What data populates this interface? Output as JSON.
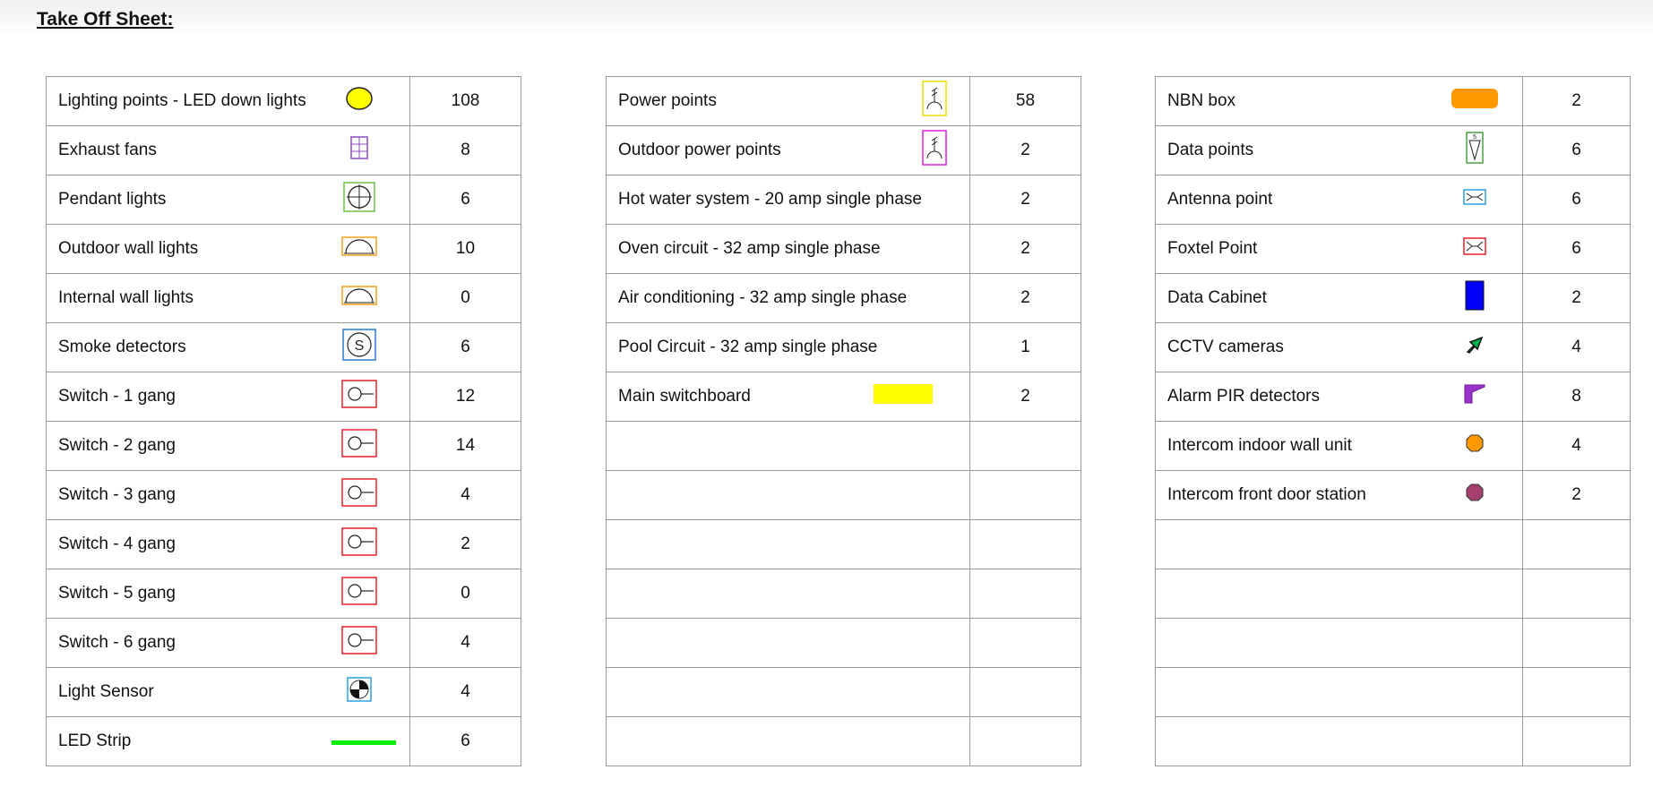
{
  "title": "Take Off Sheet:",
  "tables": [
    {
      "rows": [
        {
          "label": "Lighting points - LED down lights",
          "icon": "yellow-circle-icon",
          "qty": "108"
        },
        {
          "label": "Exhaust fans",
          "icon": "exhaust-fan-icon",
          "qty": "8"
        },
        {
          "label": "Pendant lights",
          "icon": "pendant-light-icon",
          "qty": "6"
        },
        {
          "label": "Outdoor wall lights",
          "icon": "wall-light-icon",
          "qty": "10"
        },
        {
          "label": "Internal wall lights",
          "icon": "wall-light-icon",
          "qty": "0"
        },
        {
          "label": "Smoke detectors",
          "icon": "smoke-detector-icon",
          "qty": "6"
        },
        {
          "label": "Switch - 1 gang",
          "icon": "switch-icon",
          "qty": "12"
        },
        {
          "label": "Switch - 2 gang",
          "icon": "switch-icon",
          "qty": "14"
        },
        {
          "label": "Switch - 3 gang",
          "icon": "switch-icon",
          "qty": "4"
        },
        {
          "label": "Switch - 4 gang",
          "icon": "switch-icon",
          "qty": "2"
        },
        {
          "label": "Switch - 5 gang",
          "icon": "switch-icon",
          "qty": "0"
        },
        {
          "label": "Switch - 6 gang",
          "icon": "switch-icon",
          "qty": "4"
        },
        {
          "label": "Light Sensor",
          "icon": "light-sensor-icon",
          "qty": "4"
        },
        {
          "label": "LED Strip",
          "icon": "led-strip-icon",
          "qty": "6"
        }
      ]
    },
    {
      "rows": [
        {
          "label": "Power points",
          "icon": "power-point-icon",
          "qty": "58"
        },
        {
          "label": "Outdoor power points",
          "icon": "outdoor-power-point-icon",
          "qty": "2"
        },
        {
          "label": "Hot water system - 20 amp single phase",
          "icon": "",
          "qty": "2"
        },
        {
          "label": "Oven circuit - 32 amp single phase",
          "icon": "",
          "qty": "2"
        },
        {
          "label": "Air conditioning - 32 amp single phase",
          "icon": "",
          "qty": "2"
        },
        {
          "label": "Pool Circuit - 32 amp single phase",
          "icon": "",
          "qty": "1"
        },
        {
          "label": "Main switchboard",
          "icon": "switchboard-icon",
          "qty": "2"
        },
        {
          "label": "",
          "icon": "",
          "qty": ""
        },
        {
          "label": "",
          "icon": "",
          "qty": ""
        },
        {
          "label": "",
          "icon": "",
          "qty": ""
        },
        {
          "label": "",
          "icon": "",
          "qty": ""
        },
        {
          "label": "",
          "icon": "",
          "qty": ""
        },
        {
          "label": "",
          "icon": "",
          "qty": ""
        },
        {
          "label": "",
          "icon": "",
          "qty": ""
        }
      ]
    },
    {
      "rows": [
        {
          "label": "NBN box",
          "icon": "nbn-box-icon",
          "qty": "2"
        },
        {
          "label": "Data points",
          "icon": "data-point-icon",
          "qty": "6"
        },
        {
          "label": "Antenna point",
          "icon": "antenna-point-icon",
          "qty": "6"
        },
        {
          "label": "Foxtel Point",
          "icon": "foxtel-point-icon",
          "qty": "6"
        },
        {
          "label": "Data Cabinet",
          "icon": "data-cabinet-icon",
          "qty": "2"
        },
        {
          "label": "CCTV cameras",
          "icon": "cctv-camera-icon",
          "qty": "4"
        },
        {
          "label": "Alarm PIR detectors",
          "icon": "pir-detector-icon",
          "qty": "8"
        },
        {
          "label": "Intercom indoor wall unit",
          "icon": "intercom-indoor-icon",
          "qty": "4"
        },
        {
          "label": "Intercom front door station",
          "icon": "intercom-door-icon",
          "qty": "2"
        },
        {
          "label": "",
          "icon": "",
          "qty": ""
        },
        {
          "label": "",
          "icon": "",
          "qty": ""
        },
        {
          "label": "",
          "icon": "",
          "qty": ""
        },
        {
          "label": "",
          "icon": "",
          "qty": ""
        },
        {
          "label": "",
          "icon": "",
          "qty": ""
        }
      ]
    }
  ],
  "colors": {
    "border": "#9a9a9a",
    "yellow": "#ffff00",
    "orange": "#ff9900",
    "blue": "#0000ff",
    "green": "#00ee00",
    "switch_red": "#e8202a",
    "purple": "#9933cc",
    "plum": "#a3406e"
  }
}
